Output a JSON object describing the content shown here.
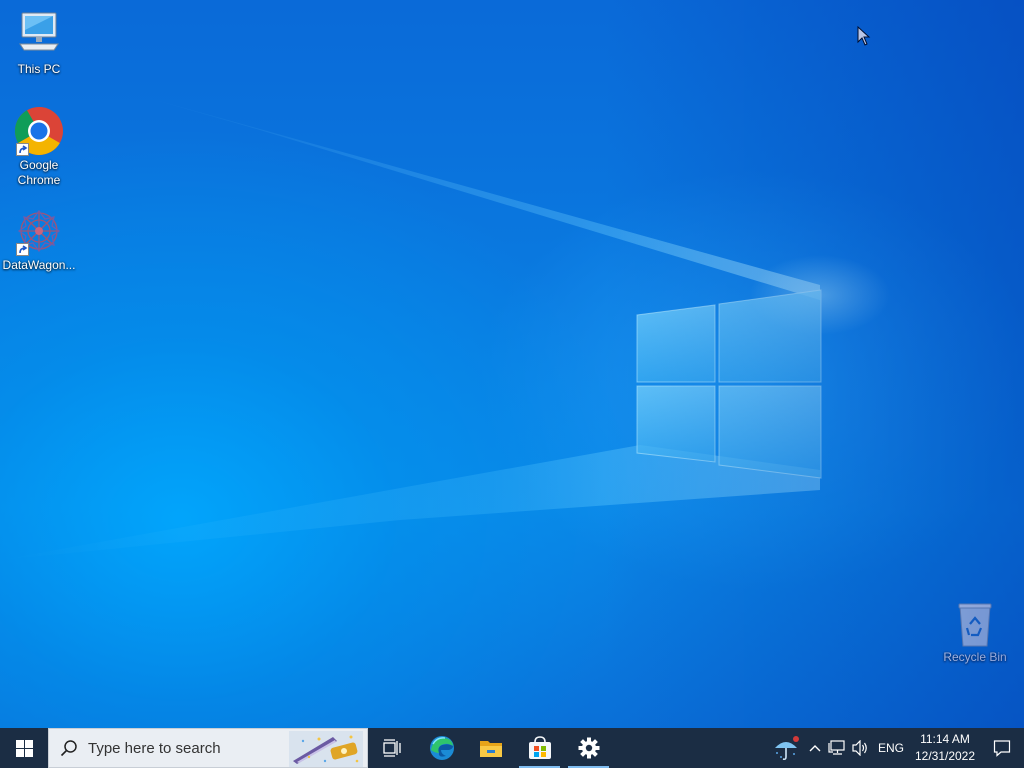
{
  "desktop": {
    "icons": [
      {
        "label": "This PC",
        "icon": "computer-icon"
      },
      {
        "label": "Google\nChrome",
        "icon": "chrome-icon"
      },
      {
        "label": "DataWagon...",
        "icon": "datawagon-icon"
      },
      {
        "label": "Recycle Bin",
        "icon": "recycle-bin-icon"
      }
    ]
  },
  "taskbar": {
    "start_icon": "windows-logo-icon",
    "search": {
      "placeholder": "Type here to search",
      "icon": "search-icon"
    },
    "apps": [
      {
        "name": "Task View",
        "icon": "task-view-icon"
      },
      {
        "name": "Microsoft Edge",
        "icon": "edge-icon"
      },
      {
        "name": "File Explorer",
        "icon": "file-explorer-icon"
      },
      {
        "name": "Microsoft Store",
        "icon": "store-icon"
      },
      {
        "name": "Settings",
        "icon": "gear-icon"
      }
    ],
    "tray": {
      "weather_icon": "weather-umbrella-icon",
      "language": "ENG",
      "time": "11:14 AM",
      "date": "12/31/2022"
    }
  },
  "colors": {
    "taskbar": "#1b2d44",
    "wallpaper_accent": "#0a7ae0",
    "search_box": "#eaeef3"
  }
}
